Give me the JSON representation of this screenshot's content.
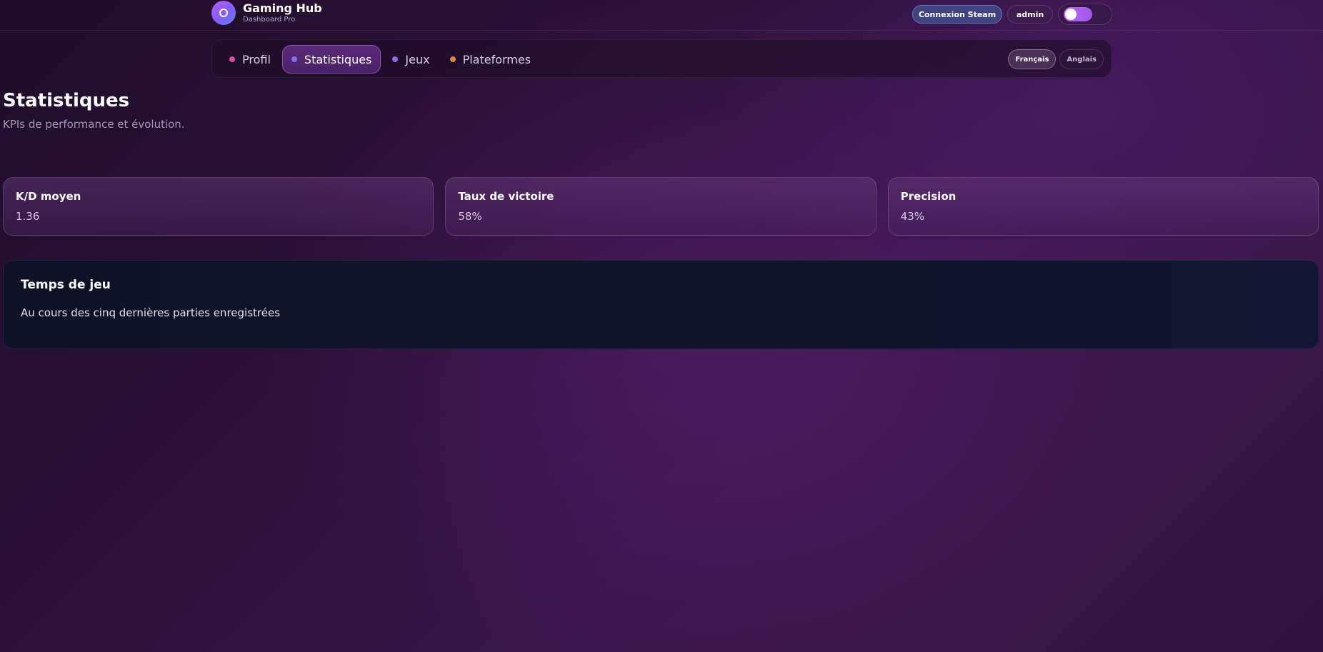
{
  "brand": {
    "title": "Gaming Hub",
    "subtitle": "Dashboard Pro"
  },
  "top_actions": {
    "steam_label": "Connexion Steam",
    "user_label": "admin",
    "theme_toggle_on": true
  },
  "nav": {
    "tabs": [
      {
        "label": "Profil",
        "dot_color": "#d64fa7",
        "active": false
      },
      {
        "label": "Statistiques",
        "dot_color": "#8a6cf0",
        "active": true
      },
      {
        "label": "Jeux",
        "dot_color": "#8d6ae8",
        "active": false
      },
      {
        "label": "Plateformes",
        "dot_color": "#e0874b",
        "active": false
      }
    ],
    "languages": [
      {
        "label": "Français",
        "active": true
      },
      {
        "label": "Anglais",
        "active": false
      }
    ]
  },
  "page": {
    "title": "Statistiques",
    "subtitle": "KPIs de performance et évolution."
  },
  "kpis": [
    {
      "label": "K/D moyen",
      "value": "1.36"
    },
    {
      "label": "Taux de victoire",
      "value": "58%"
    },
    {
      "label": "Precision",
      "value": "43%"
    }
  ],
  "playtime": {
    "title": "Temps de jeu",
    "description": "Au cours des cinq dernières parties enregistrées"
  },
  "colors": {
    "accent": "#8a4fb3",
    "steam_button": "#3f437f",
    "toggle": "#c264f5"
  }
}
